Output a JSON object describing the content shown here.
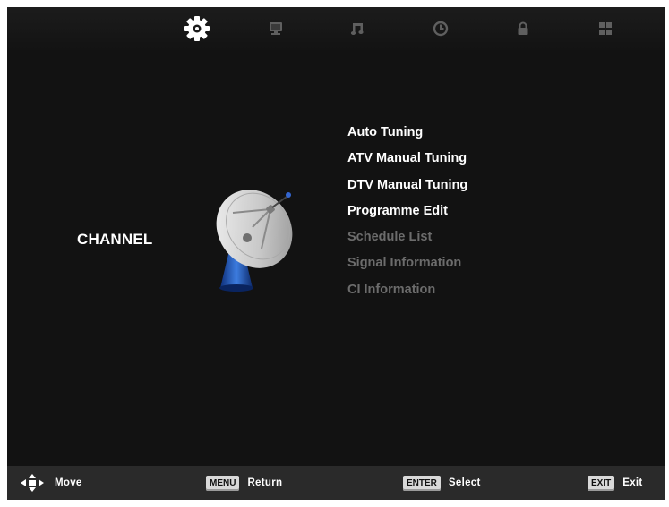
{
  "tabs": [
    {
      "icon": "gear-icon",
      "active": true
    },
    {
      "icon": "monitor-icon",
      "active": false
    },
    {
      "icon": "music-icon",
      "active": false
    },
    {
      "icon": "clock-icon",
      "active": false
    },
    {
      "icon": "lock-icon",
      "active": false
    },
    {
      "icon": "grid-icon",
      "active": false
    }
  ],
  "category": {
    "label": "CHANNEL",
    "icon": "satellite-dish-icon"
  },
  "menu": {
    "items": [
      {
        "label": "Auto Tuning",
        "enabled": true
      },
      {
        "label": "ATV Manual Tuning",
        "enabled": true
      },
      {
        "label": "DTV Manual Tuning",
        "enabled": true
      },
      {
        "label": "Programme Edit",
        "enabled": true
      },
      {
        "label": "Schedule List",
        "enabled": false
      },
      {
        "label": "Signal Information",
        "enabled": false
      },
      {
        "label": "CI Information",
        "enabled": false
      }
    ]
  },
  "footer": {
    "move": {
      "icon": "arrows-icon",
      "label": "Move"
    },
    "return": {
      "key": "MENU",
      "label": "Return"
    },
    "select": {
      "key": "ENTER",
      "label": "Select"
    },
    "exit": {
      "key": "EXIT",
      "label": "Exit"
    }
  },
  "colors": {
    "background": "#121212",
    "bar": "#2a2a2a",
    "active_icon": "#ffffff",
    "inactive_icon": "#5f5f5f",
    "disabled_text": "#6c6c6c"
  }
}
